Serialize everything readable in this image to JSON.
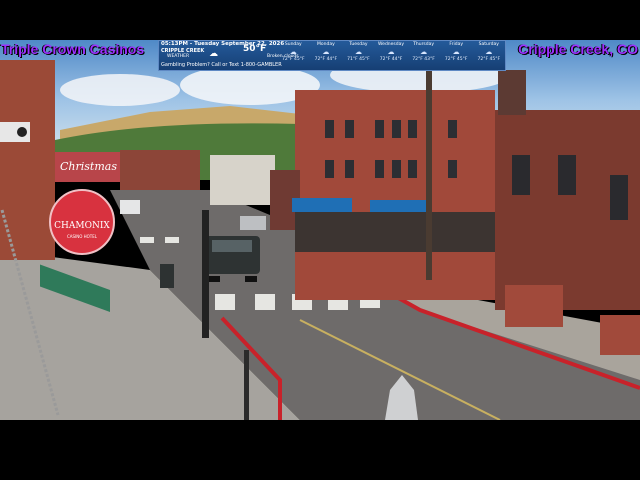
{
  "overlay": {
    "left_label": "Triple Crown Casinos",
    "right_label": "Cripple Creek, CO",
    "colors": {
      "label_purple": "#9b30ff",
      "weather_bar": "#1f4f8a"
    }
  },
  "weather": {
    "time": "05:13PM - Tuesday September 22, 2026",
    "location": "CRIPPLE CREEK",
    "source": "WEATHER",
    "temperature": "50°F",
    "condition": "Broken clouds",
    "promo": "Gambling Problem? Call or Text 1-800-GAMBLER",
    "icon": "cloud-icon",
    "forecast": [
      {
        "day": "Sunday",
        "temps": "72°F 45°F"
      },
      {
        "day": "Monday",
        "temps": "72°F 44°F"
      },
      {
        "day": "Tuesday",
        "temps": "71°F 45°F"
      },
      {
        "day": "Wednesday",
        "temps": "72°F 44°F"
      },
      {
        "day": "Thursday",
        "temps": "72°F 43°F"
      },
      {
        "day": "Friday",
        "temps": "72°F 45°F"
      },
      {
        "day": "Saturday",
        "temps": "72°F 45°F"
      }
    ]
  },
  "scene": {
    "signs": {
      "christmas": "Christmas",
      "chamonix": "CHAMONIX",
      "chamonix_sub": "CASINO HOTEL"
    }
  }
}
